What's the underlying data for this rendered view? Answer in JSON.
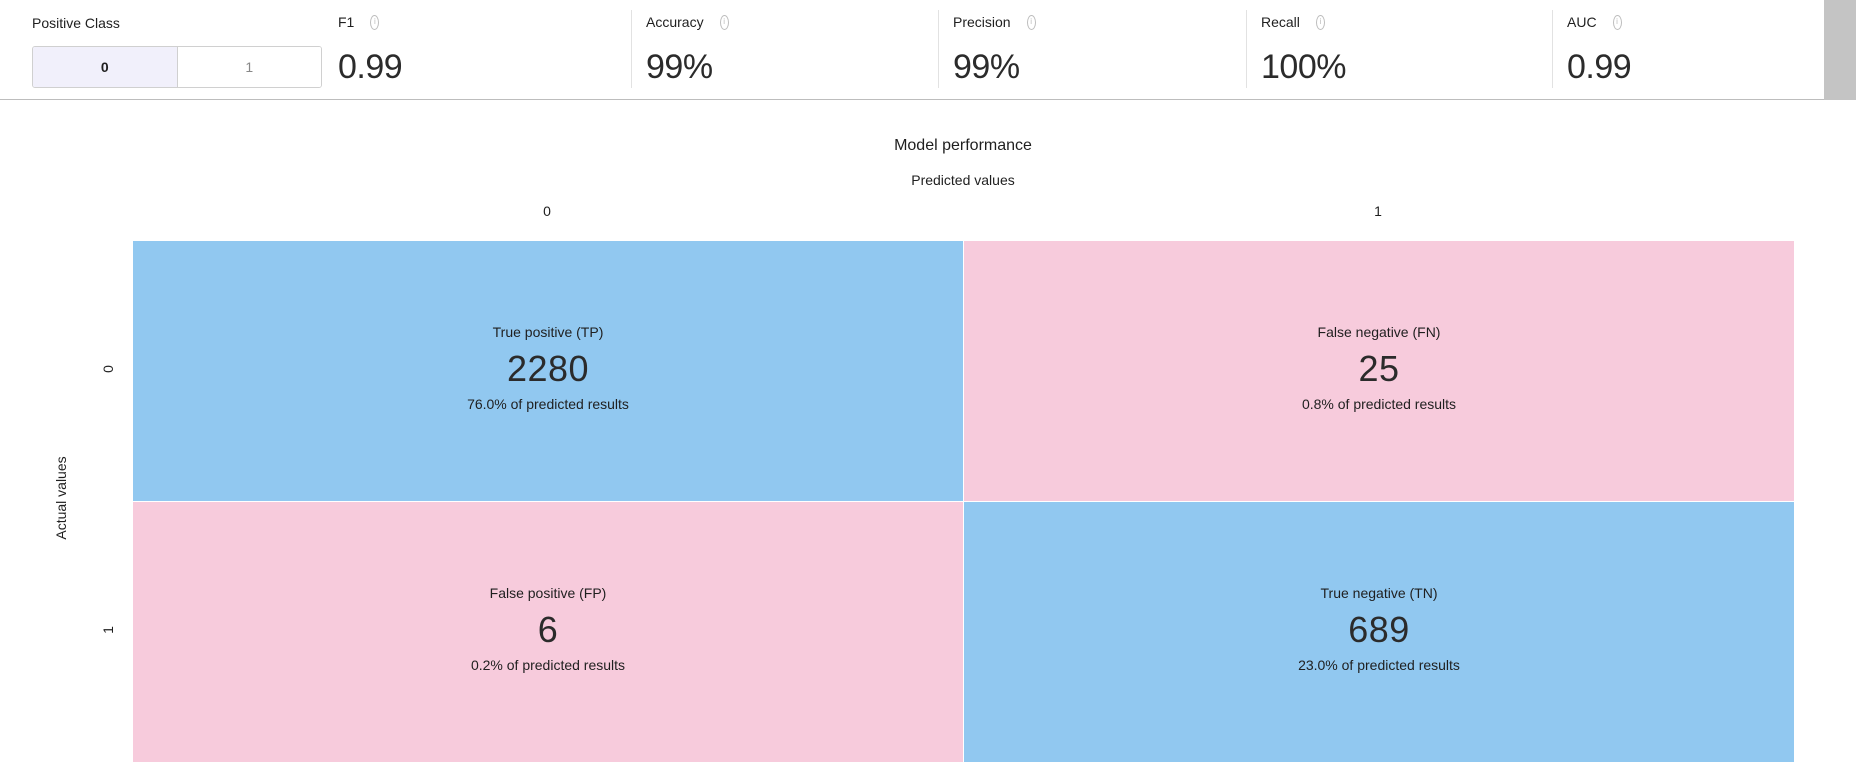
{
  "positive_class": {
    "label": "Positive Class",
    "options": [
      "0",
      "1"
    ],
    "selected": "0"
  },
  "metrics": [
    {
      "label": "F1",
      "value": "0.99"
    },
    {
      "label": "Accuracy",
      "value": "99%"
    },
    {
      "label": "Precision",
      "value": "99%"
    },
    {
      "label": "Recall",
      "value": "100%"
    },
    {
      "label": "AUC",
      "value": "0.99"
    }
  ],
  "chart_data": {
    "type": "heatmap",
    "title": "Model performance",
    "xlabel": "Predicted values",
    "ylabel": "Actual values",
    "x_categories": [
      "0",
      "1"
    ],
    "y_categories": [
      "0",
      "1"
    ],
    "cells": [
      {
        "name": "True positive (TP)",
        "count": "2280",
        "pct": "76.0% of predicted results",
        "actual": "0",
        "predicted": "0",
        "color": "#91c8f0"
      },
      {
        "name": "False negative (FN)",
        "count": "25",
        "pct": "0.8% of predicted results",
        "actual": "0",
        "predicted": "1",
        "color": "#f7cbdc"
      },
      {
        "name": "False positive (FP)",
        "count": "6",
        "pct": "0.2% of predicted results",
        "actual": "1",
        "predicted": "0",
        "color": "#f7cbdc"
      },
      {
        "name": "True negative (TN)",
        "count": "689",
        "pct": "23.0% of predicted results",
        "actual": "1",
        "predicted": "1",
        "color": "#91c8f0"
      }
    ]
  }
}
